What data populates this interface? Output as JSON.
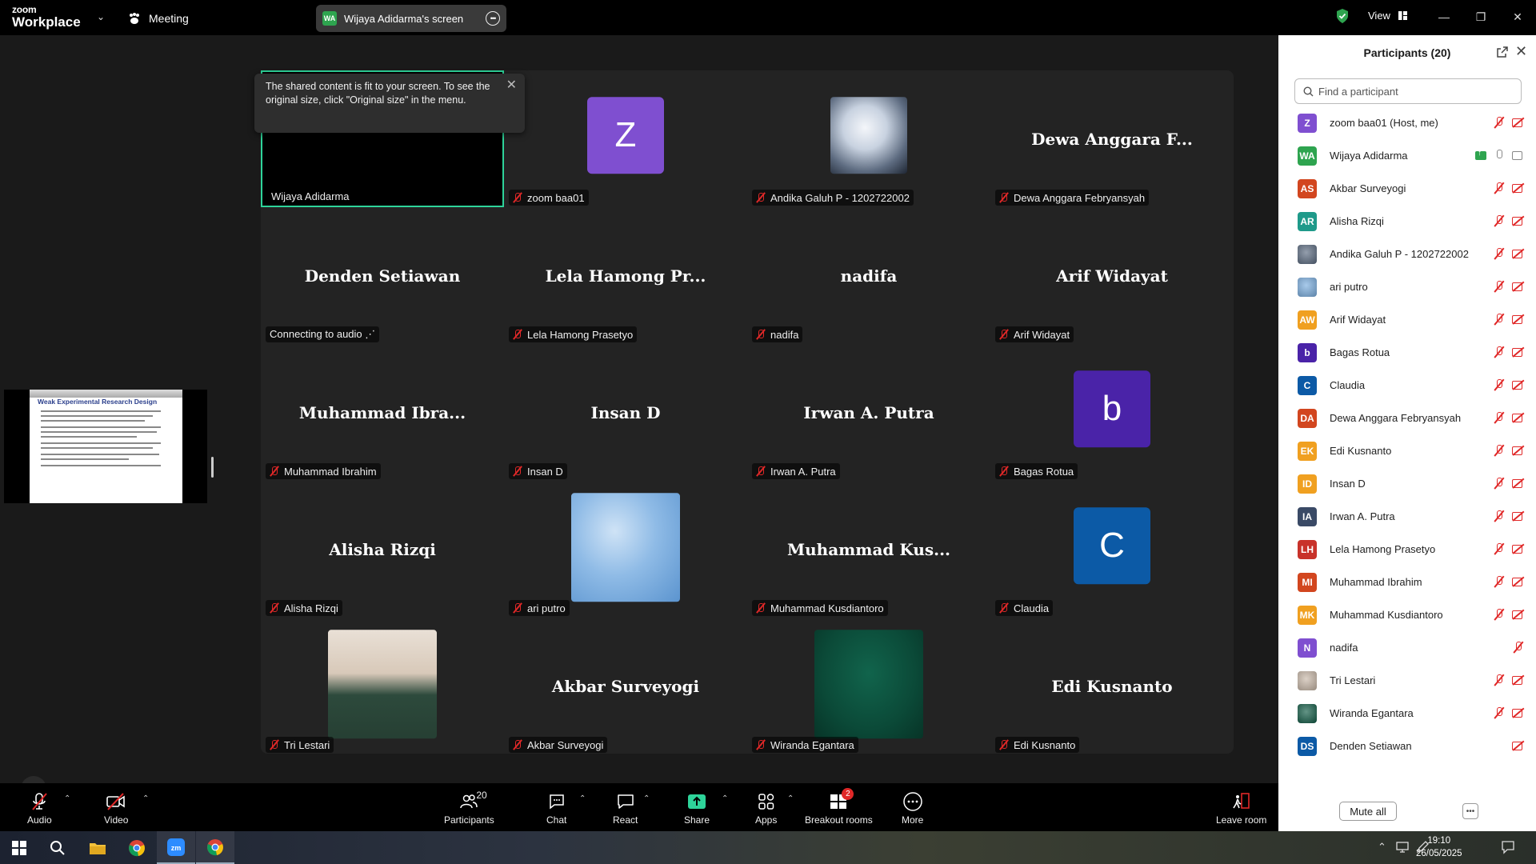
{
  "app": {
    "logo_line1": "zoom",
    "logo_line2": "Workplace",
    "meeting_label": "Meeting",
    "share_initials": "WA",
    "share_title": "Wijaya Adidarma's screen",
    "view_label": "View",
    "accent": "#2ed49a"
  },
  "tooltip": {
    "text": "The shared content is fit to your screen. To see the original size, click \"Original size\" in the menu."
  },
  "slide_thumb": {
    "title": "Weak Experimental Research Design"
  },
  "tiles": [
    {
      "big": "",
      "label": "Wijaya Adidarma",
      "muted": false,
      "kind": "active"
    },
    {
      "big": "",
      "label": "zoom baa01",
      "muted": true,
      "kind": "avatar",
      "letter": "Z",
      "color": "#7f4fd0"
    },
    {
      "big": "",
      "label": "Andika Galuh P - 1202722002",
      "muted": true,
      "kind": "photo",
      "photo": "anime"
    },
    {
      "big": "Dewa Anggara F...",
      "label": "Dewa Anggara Febryansyah",
      "muted": true,
      "kind": "name"
    },
    {
      "big": "Denden Setiawan",
      "label": "Connecting to audio ⋰",
      "muted": false,
      "kind": "name"
    },
    {
      "big": "Lela Hamong Pr...",
      "label": "Lela Hamong Prasetyo",
      "muted": true,
      "kind": "name"
    },
    {
      "big": "nadifa",
      "label": "nadifa",
      "muted": true,
      "kind": "name"
    },
    {
      "big": "Arif Widayat",
      "label": "Arif Widayat",
      "muted": true,
      "kind": "name"
    },
    {
      "big": "Muhammad  Ibra...",
      "label": "Muhammad Ibrahim",
      "muted": true,
      "kind": "name"
    },
    {
      "big": "Insan D",
      "label": "Insan D",
      "muted": true,
      "kind": "name"
    },
    {
      "big": "Irwan A. Putra",
      "label": "Irwan A. Putra",
      "muted": true,
      "kind": "name"
    },
    {
      "big": "",
      "label": "Bagas Rotua",
      "muted": true,
      "kind": "avatar",
      "letter": "b",
      "color": "#4a23a8"
    },
    {
      "big": "Alisha Rizqi",
      "label": "Alisha Rizqi",
      "muted": true,
      "kind": "name"
    },
    {
      "big": "",
      "label": "ari putro",
      "muted": true,
      "kind": "photo",
      "photo": "blue"
    },
    {
      "big": "Muhammad  Kus...",
      "label": "Muhammad Kusdiantoro",
      "muted": true,
      "kind": "name"
    },
    {
      "big": "",
      "label": "Claudia",
      "muted": true,
      "kind": "avatar",
      "letter": "C",
      "color": "#0c5aa6"
    },
    {
      "big": "",
      "label": "Tri Lestari",
      "muted": true,
      "kind": "photo",
      "photo": "woman"
    },
    {
      "big": "Akbar Surveyogi",
      "label": "Akbar Surveyogi",
      "muted": true,
      "kind": "name"
    },
    {
      "big": "",
      "label": "Wiranda Egantara",
      "muted": true,
      "kind": "photo",
      "photo": "green"
    },
    {
      "big": "Edi Kusnanto",
      "label": "Edi Kusnanto",
      "muted": true,
      "kind": "name"
    }
  ],
  "panel": {
    "title": "Participants (20)",
    "search_placeholder": "Find a participant",
    "mute_all": "Mute all",
    "participants": [
      {
        "initials": "Z",
        "name": "zoom baa01 (Host, me)",
        "color": "#7f4fd0",
        "mic": "muted",
        "cam": "off"
      },
      {
        "initials": "WA",
        "name": "Wijaya Adidarma",
        "color": "#2ea44f",
        "mic": "on",
        "cam": "on",
        "sharing": true
      },
      {
        "initials": "AS",
        "name": "Akbar Surveyogi",
        "color": "#d2461f",
        "mic": "muted",
        "cam": "off"
      },
      {
        "initials": "AR",
        "name": "Alisha Rizqi",
        "color": "#1f9a8a",
        "mic": "muted",
        "cam": "off"
      },
      {
        "initials": "",
        "name": "Andika Galuh P - 1202722002",
        "color": "#5a6a80",
        "mic": "muted",
        "cam": "off",
        "photo": true
      },
      {
        "initials": "",
        "name": "ari putro",
        "color": "#7aaee0",
        "mic": "muted",
        "cam": "off",
        "photo": true
      },
      {
        "initials": "AW",
        "name": "Arif Widayat",
        "color": "#f0a020",
        "mic": "muted",
        "cam": "off"
      },
      {
        "initials": "b",
        "name": "Bagas Rotua",
        "color": "#4a23a8",
        "mic": "muted",
        "cam": "off"
      },
      {
        "initials": "C",
        "name": "Claudia",
        "color": "#0c5aa6",
        "mic": "muted",
        "cam": "off"
      },
      {
        "initials": "DA",
        "name": "Dewa Anggara Febryansyah",
        "color": "#d2461f",
        "mic": "muted",
        "cam": "off"
      },
      {
        "initials": "EK",
        "name": "Edi Kusnanto",
        "color": "#f0a020",
        "mic": "muted",
        "cam": "off"
      },
      {
        "initials": "ID",
        "name": "Insan D",
        "color": "#f0a020",
        "mic": "muted",
        "cam": "off"
      },
      {
        "initials": "IA",
        "name": "Irwan A. Putra",
        "color": "#3a4a66",
        "mic": "muted",
        "cam": "off"
      },
      {
        "initials": "LH",
        "name": "Lela Hamong Prasetyo",
        "color": "#c8322a",
        "mic": "muted",
        "cam": "off"
      },
      {
        "initials": "MI",
        "name": "Muhammad Ibrahim",
        "color": "#d2461f",
        "mic": "muted",
        "cam": "off"
      },
      {
        "initials": "MK",
        "name": "Muhammad Kusdiantoro",
        "color": "#f0a020",
        "mic": "muted",
        "cam": "off"
      },
      {
        "initials": "N",
        "name": "nadifa",
        "color": "#7f4fd0",
        "mic": "muted",
        "cam": "none"
      },
      {
        "initials": "",
        "name": "Tri Lestari",
        "color": "#c9b8a8",
        "mic": "muted",
        "cam": "off",
        "photo": true
      },
      {
        "initials": "",
        "name": "Wiranda Egantara",
        "color": "#0f5a44",
        "mic": "muted",
        "cam": "off",
        "photo": true
      },
      {
        "initials": "DS",
        "name": "Denden Setiawan",
        "color": "#0c5aa6",
        "mic": "none",
        "cam": "off"
      }
    ]
  },
  "toolbar": {
    "audio": "Audio",
    "video": "Video",
    "participants": "Participants",
    "participants_count": "20",
    "chat": "Chat",
    "react": "React",
    "share": "Share",
    "apps": "Apps",
    "breakout": "Breakout rooms",
    "breakout_badge": "2",
    "more": "More",
    "leave": "Leave room"
  },
  "taskbar": {
    "time": "19:10",
    "date": "26/05/2025"
  }
}
